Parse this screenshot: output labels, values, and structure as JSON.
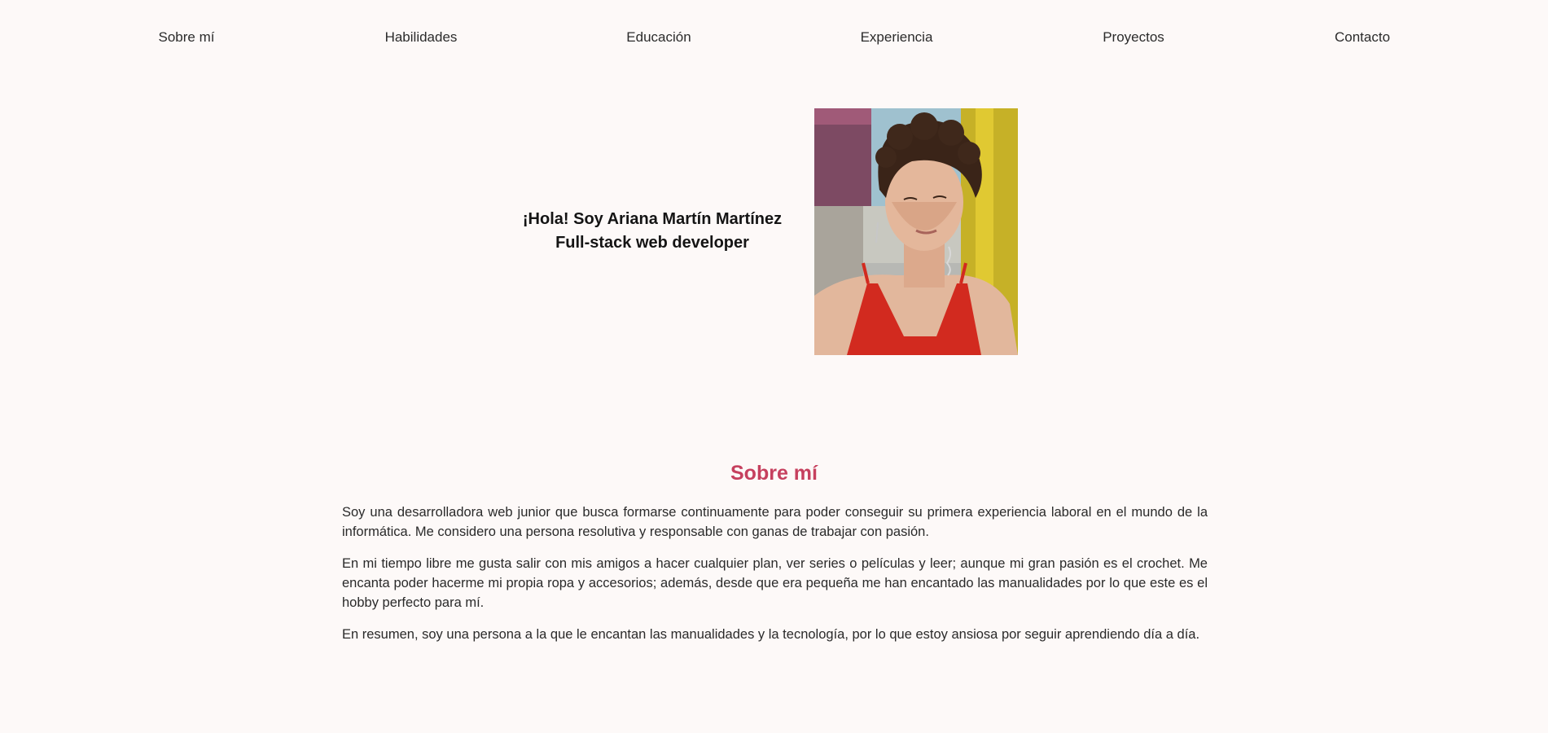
{
  "nav": {
    "items": [
      {
        "label": "Sobre mí"
      },
      {
        "label": "Habilidades"
      },
      {
        "label": "Educación"
      },
      {
        "label": "Experiencia"
      },
      {
        "label": "Proyectos"
      },
      {
        "label": "Contacto"
      }
    ]
  },
  "hero": {
    "greeting": "¡Hola! Soy Ariana Martín Martínez",
    "role": "Full-stack web developer"
  },
  "about": {
    "title": "Sobre mí",
    "paragraphs": [
      "Soy una desarrolladora web junior que busca formarse continuamente para poder conseguir su primera experiencia laboral en el mundo de la informática. Me considero una persona resolutiva y responsable con ganas de trabajar con pasión.",
      "En mi tiempo libre me gusta salir con mis amigos a hacer cualquier plan, ver series o películas y leer; aunque mi gran pasión es el crochet. Me encanta poder hacerme mi propia ropa y accesorios; además, desde que era pequeña me han encantado las manualidades por lo que este es el hobby perfecto para mí.",
      "En resumen, soy una persona a la que le encantan las manualidades y la tecnología, por lo que estoy ansiosa por seguir aprendiendo día a día."
    ]
  },
  "colors": {
    "background": "#fdf9f8",
    "accent": "#c6405e",
    "text": "#222222"
  }
}
